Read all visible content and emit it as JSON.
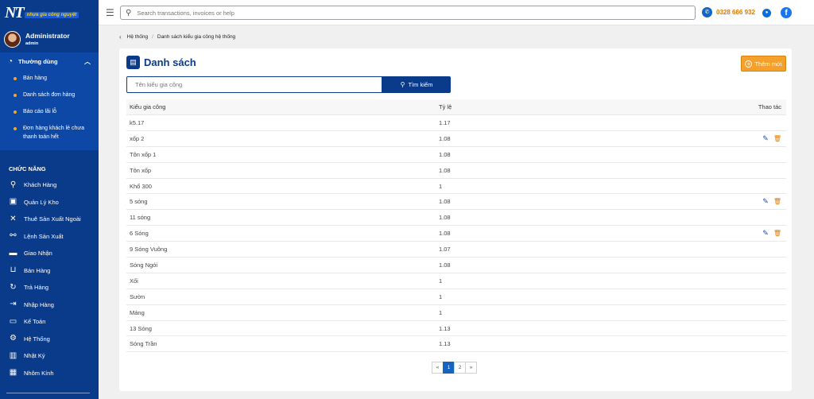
{
  "app": {
    "logo_mark": "NT",
    "logo_text": "nhựa gia công nguyệt",
    "user_name": "Administrator",
    "user_role": "admin"
  },
  "topbar": {
    "search_placeholder": "Search transactions, invoices or help",
    "phone": "0328 666 932"
  },
  "sidebar": {
    "group_title": "Thường dùng",
    "group_items": [
      {
        "label": "Bán hàng"
      },
      {
        "label": "Danh sách đơn hàng"
      },
      {
        "label": "Báo cáo lãi lỗ"
      },
      {
        "label": "Đơn hàng khách lẻ chưa thanh toán hết"
      }
    ],
    "section_title": "CHỨC NĂNG",
    "nav": [
      {
        "label": "Khách Hàng",
        "icon": "user-run-icon"
      },
      {
        "label": "Quản Lý Kho",
        "icon": "trash-box-icon"
      },
      {
        "label": "Thuê Sản Xuất Ngoài",
        "icon": "tools-icon"
      },
      {
        "label": "Lệnh Sản Xuất",
        "icon": "share-icon"
      },
      {
        "label": "Giao Nhận",
        "icon": "truck-icon"
      },
      {
        "label": "Bán Hàng",
        "icon": "cart-icon"
      },
      {
        "label": "Trả Hàng",
        "icon": "return-icon"
      },
      {
        "label": "Nhập Hàng",
        "icon": "import-icon"
      },
      {
        "label": "Kế Toán",
        "icon": "briefcase-icon"
      },
      {
        "label": "Hệ Thống",
        "icon": "settings-icon"
      },
      {
        "label": "Nhật Ký",
        "icon": "chart-icon"
      },
      {
        "label": "Nhôm Kính",
        "icon": "building-icon"
      }
    ]
  },
  "breadcrumb": {
    "items": [
      "Hệ thống",
      "Danh sách kiểu gia công hệ thống"
    ]
  },
  "main": {
    "title": "Danh sách",
    "add_label": "Thêm mới",
    "filter_placeholder": "Tên kiểu gia công",
    "search_label": "Tìm kiếm",
    "columns": [
      "Kiểu gia công",
      "Tỷ lệ",
      "Thao tác"
    ],
    "rows": [
      {
        "name": "k5.17",
        "ratio": "1.17",
        "actions": false
      },
      {
        "name": "xốp 2",
        "ratio": "1.08",
        "actions": true
      },
      {
        "name": "Tôn xốp 1",
        "ratio": "1.08",
        "actions": false
      },
      {
        "name": "Tôn xốp",
        "ratio": "1.08",
        "actions": false
      },
      {
        "name": "Khổ 300",
        "ratio": "1",
        "actions": false
      },
      {
        "name": "5 sóng",
        "ratio": "1.08",
        "actions": true
      },
      {
        "name": "11 sóng",
        "ratio": "1.08",
        "actions": false
      },
      {
        "name": "6 Sóng",
        "ratio": "1.08",
        "actions": true
      },
      {
        "name": "9 Sóng Vuông",
        "ratio": "1.07",
        "actions": false
      },
      {
        "name": "Sóng Ngói",
        "ratio": "1.08",
        "actions": false
      },
      {
        "name": "Xối",
        "ratio": "1",
        "actions": false
      },
      {
        "name": "Sườn",
        "ratio": "1",
        "actions": false
      },
      {
        "name": "Máng",
        "ratio": "1",
        "actions": false
      },
      {
        "name": "13 Sóng",
        "ratio": "1.13",
        "actions": false
      },
      {
        "name": "Sóng Trần",
        "ratio": "1.13",
        "actions": false
      }
    ],
    "pagination": {
      "prev": "«",
      "pages": [
        "1",
        "2"
      ],
      "current": "1",
      "next": "»"
    }
  },
  "colors": {
    "sidebar": "#0a3a8a",
    "accent": "#f5a02a",
    "primary": "#0a3a8a"
  }
}
